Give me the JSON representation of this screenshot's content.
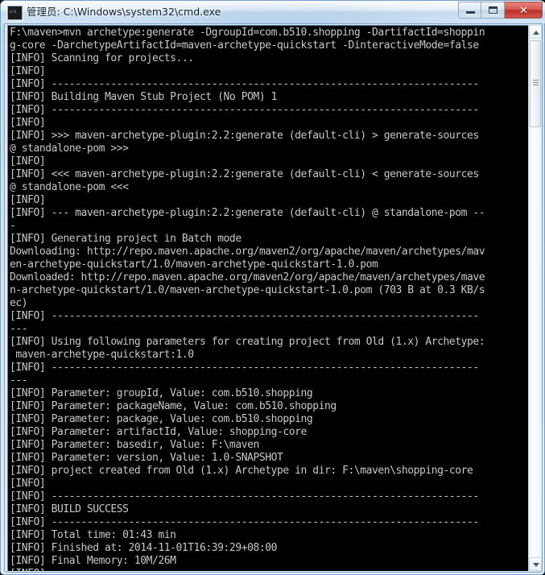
{
  "window": {
    "title": "管理员: C:\\Windows\\system32\\cmd.exe",
    "icon_name": "cmd-icon",
    "icon_glyph": "c:\\",
    "controls": {
      "minimize_label": "Minimize",
      "maximize_label": "Maximize",
      "close_label": "✕"
    }
  },
  "scrollbar": {
    "up_arrow_label": "▲",
    "down_arrow_label": "▼"
  },
  "console": {
    "prompt": "F:\\maven>",
    "command": "mvn archetype:generate -DgroupId=com.b510.shopping -DartifactId=shopping-core -DarchetypeArtifactId=maven-archetype-quickstart -DinteractiveMode=false",
    "lines": [
      "F:\\maven>mvn archetype:generate -DgroupId=com.b510.shopping -DartifactId=shoppin",
      "g-core -DarchetypeArtifactId=maven-archetype-quickstart -DinteractiveMode=false",
      "[INFO] Scanning for projects...",
      "[INFO]",
      "[INFO] ------------------------------------------------------------------------",
      "[INFO] Building Maven Stub Project (No POM) 1",
      "[INFO] ------------------------------------------------------------------------",
      "[INFO]",
      "[INFO] >>> maven-archetype-plugin:2.2:generate (default-cli) > generate-sources",
      "@ standalone-pom >>>",
      "[INFO]",
      "[INFO] <<< maven-archetype-plugin:2.2:generate (default-cli) < generate-sources",
      "@ standalone-pom <<<",
      "[INFO]",
      "[INFO] --- maven-archetype-plugin:2.2:generate (default-cli) @ standalone-pom --",
      "-",
      "[INFO] Generating project in Batch mode",
      "Downloading: http://repo.maven.apache.org/maven2/org/apache/maven/archetypes/mav",
      "en-archetype-quickstart/1.0/maven-archetype-quickstart-1.0.pom",
      "Downloaded: http://repo.maven.apache.org/maven2/org/apache/maven/archetypes/mave",
      "n-archetype-quickstart/1.0/maven-archetype-quickstart-1.0.pom (703 B at 0.3 KB/s",
      "ec)",
      "[INFO] ------------------------------------------------------------------------",
      "---",
      "[INFO] Using following parameters for creating project from Old (1.x) Archetype:",
      " maven-archetype-quickstart:1.0",
      "[INFO] ------------------------------------------------------------------------",
      "---",
      "[INFO] Parameter: groupId, Value: com.b510.shopping",
      "[INFO] Parameter: packageName, Value: com.b510.shopping",
      "[INFO] Parameter: package, Value: com.b510.shopping",
      "[INFO] Parameter: artifactId, Value: shopping-core",
      "[INFO] Parameter: basedir, Value: F:\\maven",
      "[INFO] Parameter: version, Value: 1.0-SNAPSHOT",
      "[INFO] project created from Old (1.x) Archetype in dir: F:\\maven\\shopping-core",
      "[INFO]",
      "[INFO] ------------------------------------------------------------------------",
      "[INFO] BUILD SUCCESS",
      "[INFO] ------------------------------------------------------------------------",
      "[INFO] Total time: 01:43 min",
      "[INFO] Finished at: 2014-11-01T16:39:29+08:00",
      "[INFO] Final Memory: 10M/26M",
      "[INFO] ------------------------------------------------------------------------"
    ],
    "build_status": "BUILD SUCCESS",
    "total_time": "01:43 min",
    "finished_at": "2014-11-01T16:39:29+08:00",
    "final_memory": "10M/26M",
    "parameters": [
      {
        "name": "groupId",
        "value": "com.b510.shopping"
      },
      {
        "name": "packageName",
        "value": "com.b510.shopping"
      },
      {
        "name": "package",
        "value": "com.b510.shopping"
      },
      {
        "name": "artifactId",
        "value": "shopping-core"
      },
      {
        "name": "basedir",
        "value": "F:\\maven"
      },
      {
        "name": "version",
        "value": "1.0-SNAPSHOT"
      }
    ],
    "archetype": "maven-archetype-quickstart:1.0",
    "project_dir": "F:\\maven\\shopping-core",
    "downloaded_size": "703 B at 0.3 KB/sec",
    "colors": {
      "background": "#000000",
      "text": "#c8c8c8",
      "titlebar_text": "#16212e",
      "close_button": "#bc2f26"
    }
  }
}
